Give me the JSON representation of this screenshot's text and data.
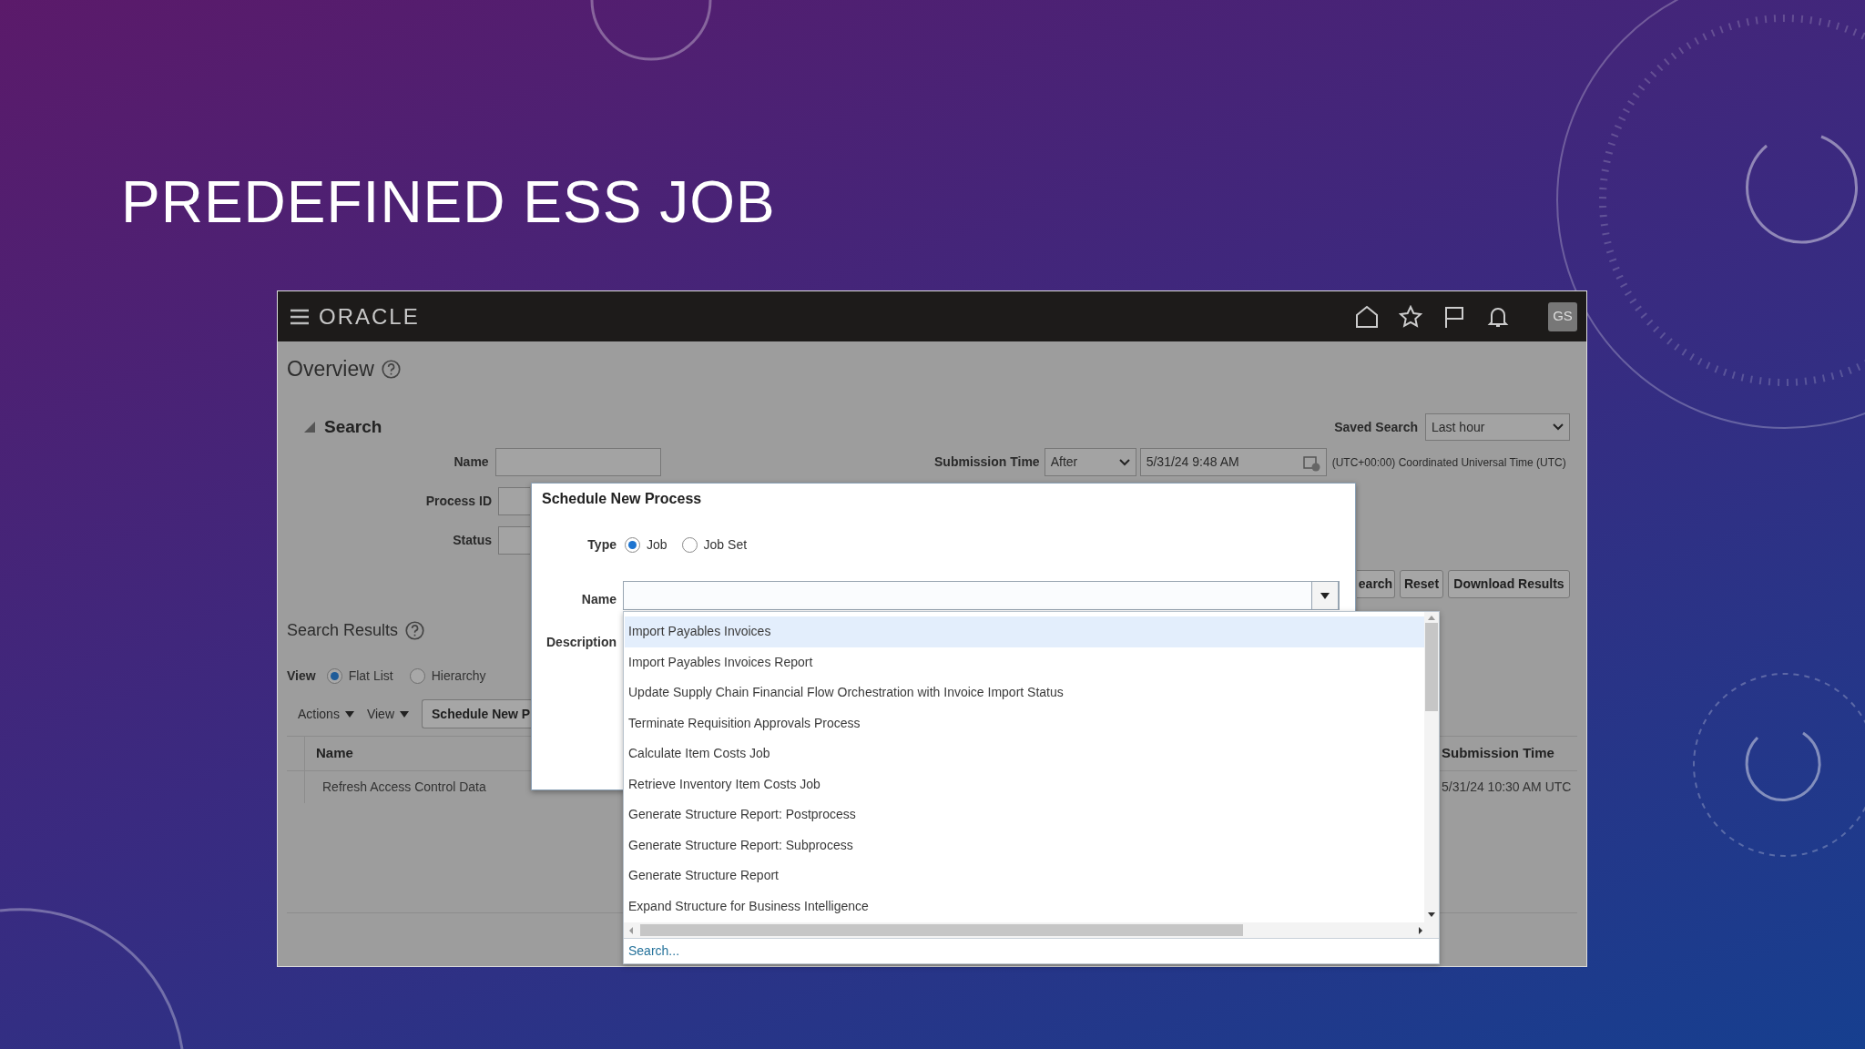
{
  "slide_title": "PREDEFINED ESS JOB",
  "app": {
    "header": {
      "logo": "ORACLE",
      "avatar": "GS"
    },
    "page": {
      "title": "Overview",
      "search": {
        "heading": "Search",
        "expanded": true,
        "fields": [
          {
            "label": "Name"
          },
          {
            "label": "Process ID"
          },
          {
            "label": "Status"
          }
        ],
        "saved_search": {
          "label": "Saved Search",
          "value": "Last hour"
        },
        "submission_time": {
          "label": "Submission Time",
          "operator": "After",
          "value": "5/31/24 9:48 AM",
          "timezone": "(UTC+00:00) Coordinated Universal Time (UTC)"
        },
        "buttons": [
          "earch",
          "Reset",
          "Download Results"
        ]
      },
      "results": {
        "heading": "Search Results",
        "view_label": "View",
        "view_options": [
          {
            "label": "Flat List",
            "selected": true
          },
          {
            "label": "Hierarchy",
            "selected": false
          }
        ],
        "menus": [
          "Actions",
          "View"
        ],
        "button": "Schedule New P",
        "table": {
          "columns": [
            "Name",
            "Submission Time"
          ],
          "rows": [
            {
              "cells": [
                "Refresh Access Control Data",
                "5/31/24 10:30 AM UTC"
              ]
            }
          ]
        }
      }
    },
    "dialog": {
      "title": "Schedule New Process",
      "type_label": "Type",
      "type_options": [
        {
          "label": "Job",
          "selected": true
        },
        {
          "label": "Job Set",
          "selected": false
        }
      ],
      "name_label": "Name",
      "description_label": "Description",
      "dropdown": {
        "items": [
          {
            "label": "Import Payables Invoices",
            "selected": true
          },
          {
            "label": "Import Payables Invoices Report",
            "selected": false
          },
          {
            "label": "Update Supply Chain Financial Flow Orchestration with Invoice Import Status",
            "selected": false
          },
          {
            "label": "Terminate Requisition Approvals Process",
            "selected": false
          },
          {
            "label": "Calculate Item Costs Job",
            "selected": false
          },
          {
            "label": "Retrieve Inventory Item Costs Job",
            "selected": false
          },
          {
            "label": "Generate Structure Report: Postprocess",
            "selected": false
          },
          {
            "label": "Generate Structure Report: Subprocess",
            "selected": false
          },
          {
            "label": "Generate Structure Report",
            "selected": false
          },
          {
            "label": "Expand Structure for Business Intelligence",
            "selected": false
          }
        ],
        "search_link": "Search..."
      }
    }
  }
}
